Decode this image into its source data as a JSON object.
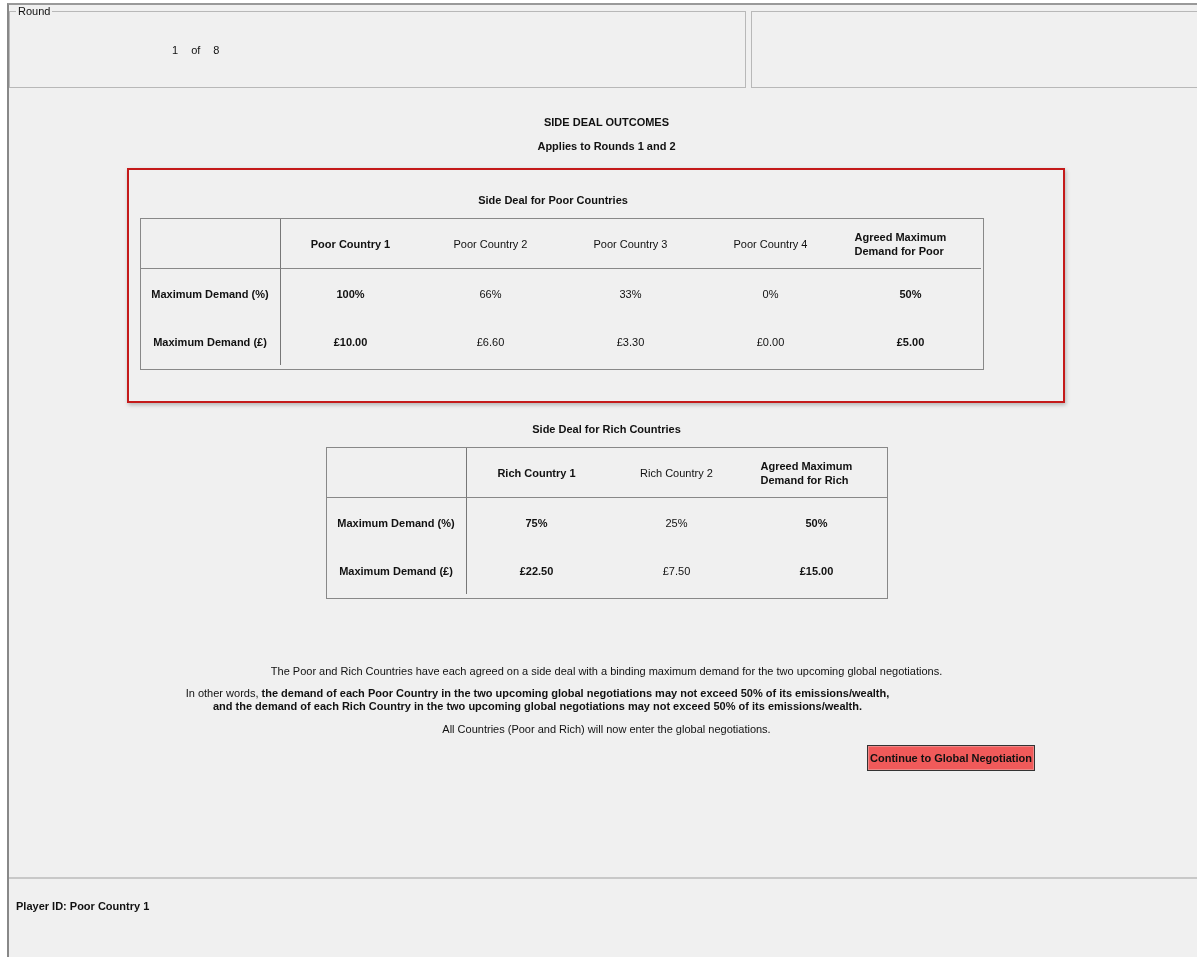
{
  "round": {
    "label": "Round",
    "current": "1",
    "of": "of",
    "total": "8"
  },
  "title": "SIDE DEAL OUTCOMES",
  "subtitle": "Applies to Rounds 1 and 2",
  "deals": [
    {
      "title": "Side Deal for Poor Countries",
      "highlighted": true,
      "row_labels": [
        "Maximum Demand (%)",
        "Maximum Demand (£)"
      ],
      "columns": [
        {
          "header": "Poor Country 1",
          "emphasized": true,
          "cells": [
            "100%",
            "£10.00"
          ]
        },
        {
          "header": "Poor Country 2",
          "emphasized": false,
          "cells": [
            "66%",
            "£6.60"
          ]
        },
        {
          "header": "Poor Country 3",
          "emphasized": false,
          "cells": [
            "33%",
            "£3.30"
          ]
        },
        {
          "header": "Poor Country 4",
          "emphasized": false,
          "cells": [
            "0%",
            "£0.00"
          ]
        },
        {
          "header": "Agreed Maximum Demand for Poor",
          "emphasized": true,
          "cells": [
            "50%",
            "£5.00"
          ]
        }
      ]
    },
    {
      "title": "Side Deal for Rich Countries",
      "highlighted": false,
      "row_labels": [
        "Maximum Demand (%)",
        "Maximum Demand (£)"
      ],
      "columns": [
        {
          "header": "Rich Country 1",
          "emphasized": true,
          "cells": [
            "75%",
            "£22.50"
          ]
        },
        {
          "header": "Rich Country 2",
          "emphasized": false,
          "cells": [
            "25%",
            "£7.50"
          ]
        },
        {
          "header": "Agreed Maximum Demand for Rich",
          "emphasized": true,
          "cells": [
            "50%",
            "£15.00"
          ]
        }
      ]
    }
  ],
  "notice": "The Poor and Rich Countries have each agreed on a side deal with a binding maximum demand for the two upcoming global negotiations.",
  "explanation_lines": [
    "In other words, **the demand of each Poor Country in the two upcoming global negotiations may not exceed 50% of its emissions/wealth,**",
    "**and the demand of each Rich Country in the two upcoming global negotiations may not exceed 50% of its emissions/wealth.**"
  ],
  "closing": "All Countries (Poor and Rich) will now enter the global negotiations.",
  "continue_button": "Continue to Global Negotiation",
  "player_id": "Player ID: Poor Country 1"
}
